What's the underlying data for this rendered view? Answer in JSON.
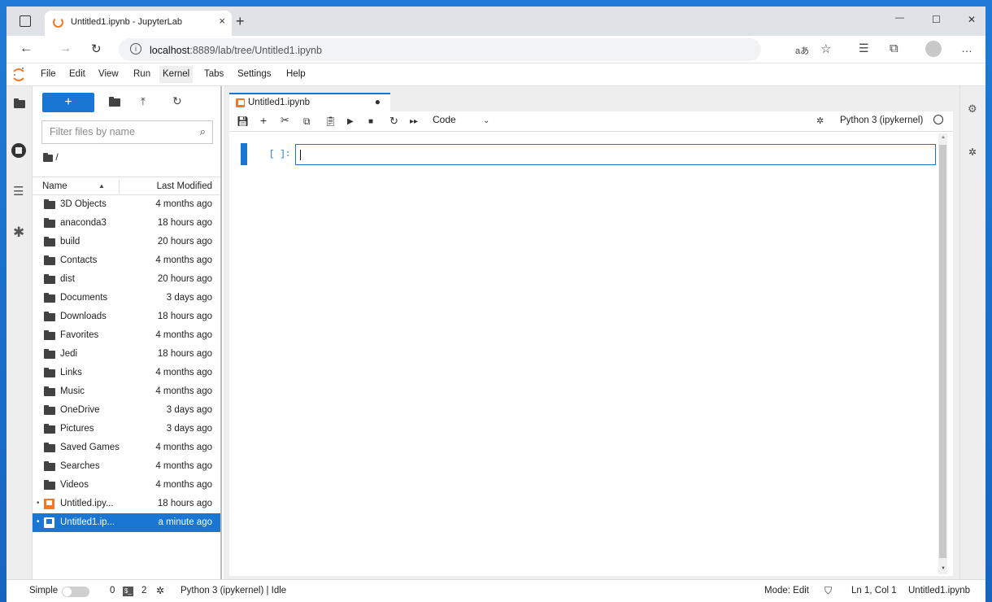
{
  "browser": {
    "tab_title": "Untitled1.ipynb - JupyterLab",
    "tab_close": "×",
    "new_tab": "+",
    "url_host": "localhost",
    "url_rest": ":8889/lab/tree/Untitled1.ipynb",
    "window_controls": [
      "—",
      "☐",
      "✕"
    ]
  },
  "menubar": [
    "File",
    "Edit",
    "View",
    "Run",
    "Kernel",
    "Tabs",
    "Settings",
    "Help"
  ],
  "active_menu": "Kernel",
  "filebrowser": {
    "new_label": "+",
    "filter_placeholder": "Filter files by name",
    "breadcrumb": "/",
    "col_name": "Name",
    "col_modified": "Last Modified",
    "files": [
      {
        "name": "3D Objects",
        "modified": "4 months ago",
        "type": "folder"
      },
      {
        "name": "anaconda3",
        "modified": "18 hours ago",
        "type": "folder"
      },
      {
        "name": "build",
        "modified": "20 hours ago",
        "type": "folder"
      },
      {
        "name": "Contacts",
        "modified": "4 months ago",
        "type": "folder"
      },
      {
        "name": "dist",
        "modified": "20 hours ago",
        "type": "folder"
      },
      {
        "name": "Documents",
        "modified": "3 days ago",
        "type": "folder"
      },
      {
        "name": "Downloads",
        "modified": "18 hours ago",
        "type": "folder"
      },
      {
        "name": "Favorites",
        "modified": "4 months ago",
        "type": "folder"
      },
      {
        "name": "Jedi",
        "modified": "18 hours ago",
        "type": "folder"
      },
      {
        "name": "Links",
        "modified": "4 months ago",
        "type": "folder"
      },
      {
        "name": "Music",
        "modified": "4 months ago",
        "type": "folder"
      },
      {
        "name": "OneDrive",
        "modified": "3 days ago",
        "type": "folder"
      },
      {
        "name": "Pictures",
        "modified": "3 days ago",
        "type": "folder"
      },
      {
        "name": "Saved Games",
        "modified": "4 months ago",
        "type": "folder"
      },
      {
        "name": "Searches",
        "modified": "4 months ago",
        "type": "folder"
      },
      {
        "name": "Videos",
        "modified": "4 months ago",
        "type": "folder"
      },
      {
        "name": "Untitled.ipy...",
        "modified": "18 hours ago",
        "type": "notebook",
        "running": true
      },
      {
        "name": "Untitled1.ip...",
        "modified": "a minute ago",
        "type": "notebook",
        "running": true,
        "selected": true
      }
    ]
  },
  "notebook": {
    "tab_label": "Untitled1.ipynb",
    "dirty_dot": "●",
    "cell_type": "Code",
    "kernel_name": "Python 3 (ipykernel)",
    "prompt": "[ ]:"
  },
  "status": {
    "simple": "Simple",
    "zero": "0",
    "two": "2",
    "kernel_status": "Python 3 (ipykernel) | Idle",
    "mode": "Mode: Edit",
    "position": "Ln 1, Col 1",
    "filename": "Untitled1.ipynb"
  },
  "colors": {
    "accent": "#1976d2",
    "jupyter_orange": "#f37726"
  }
}
